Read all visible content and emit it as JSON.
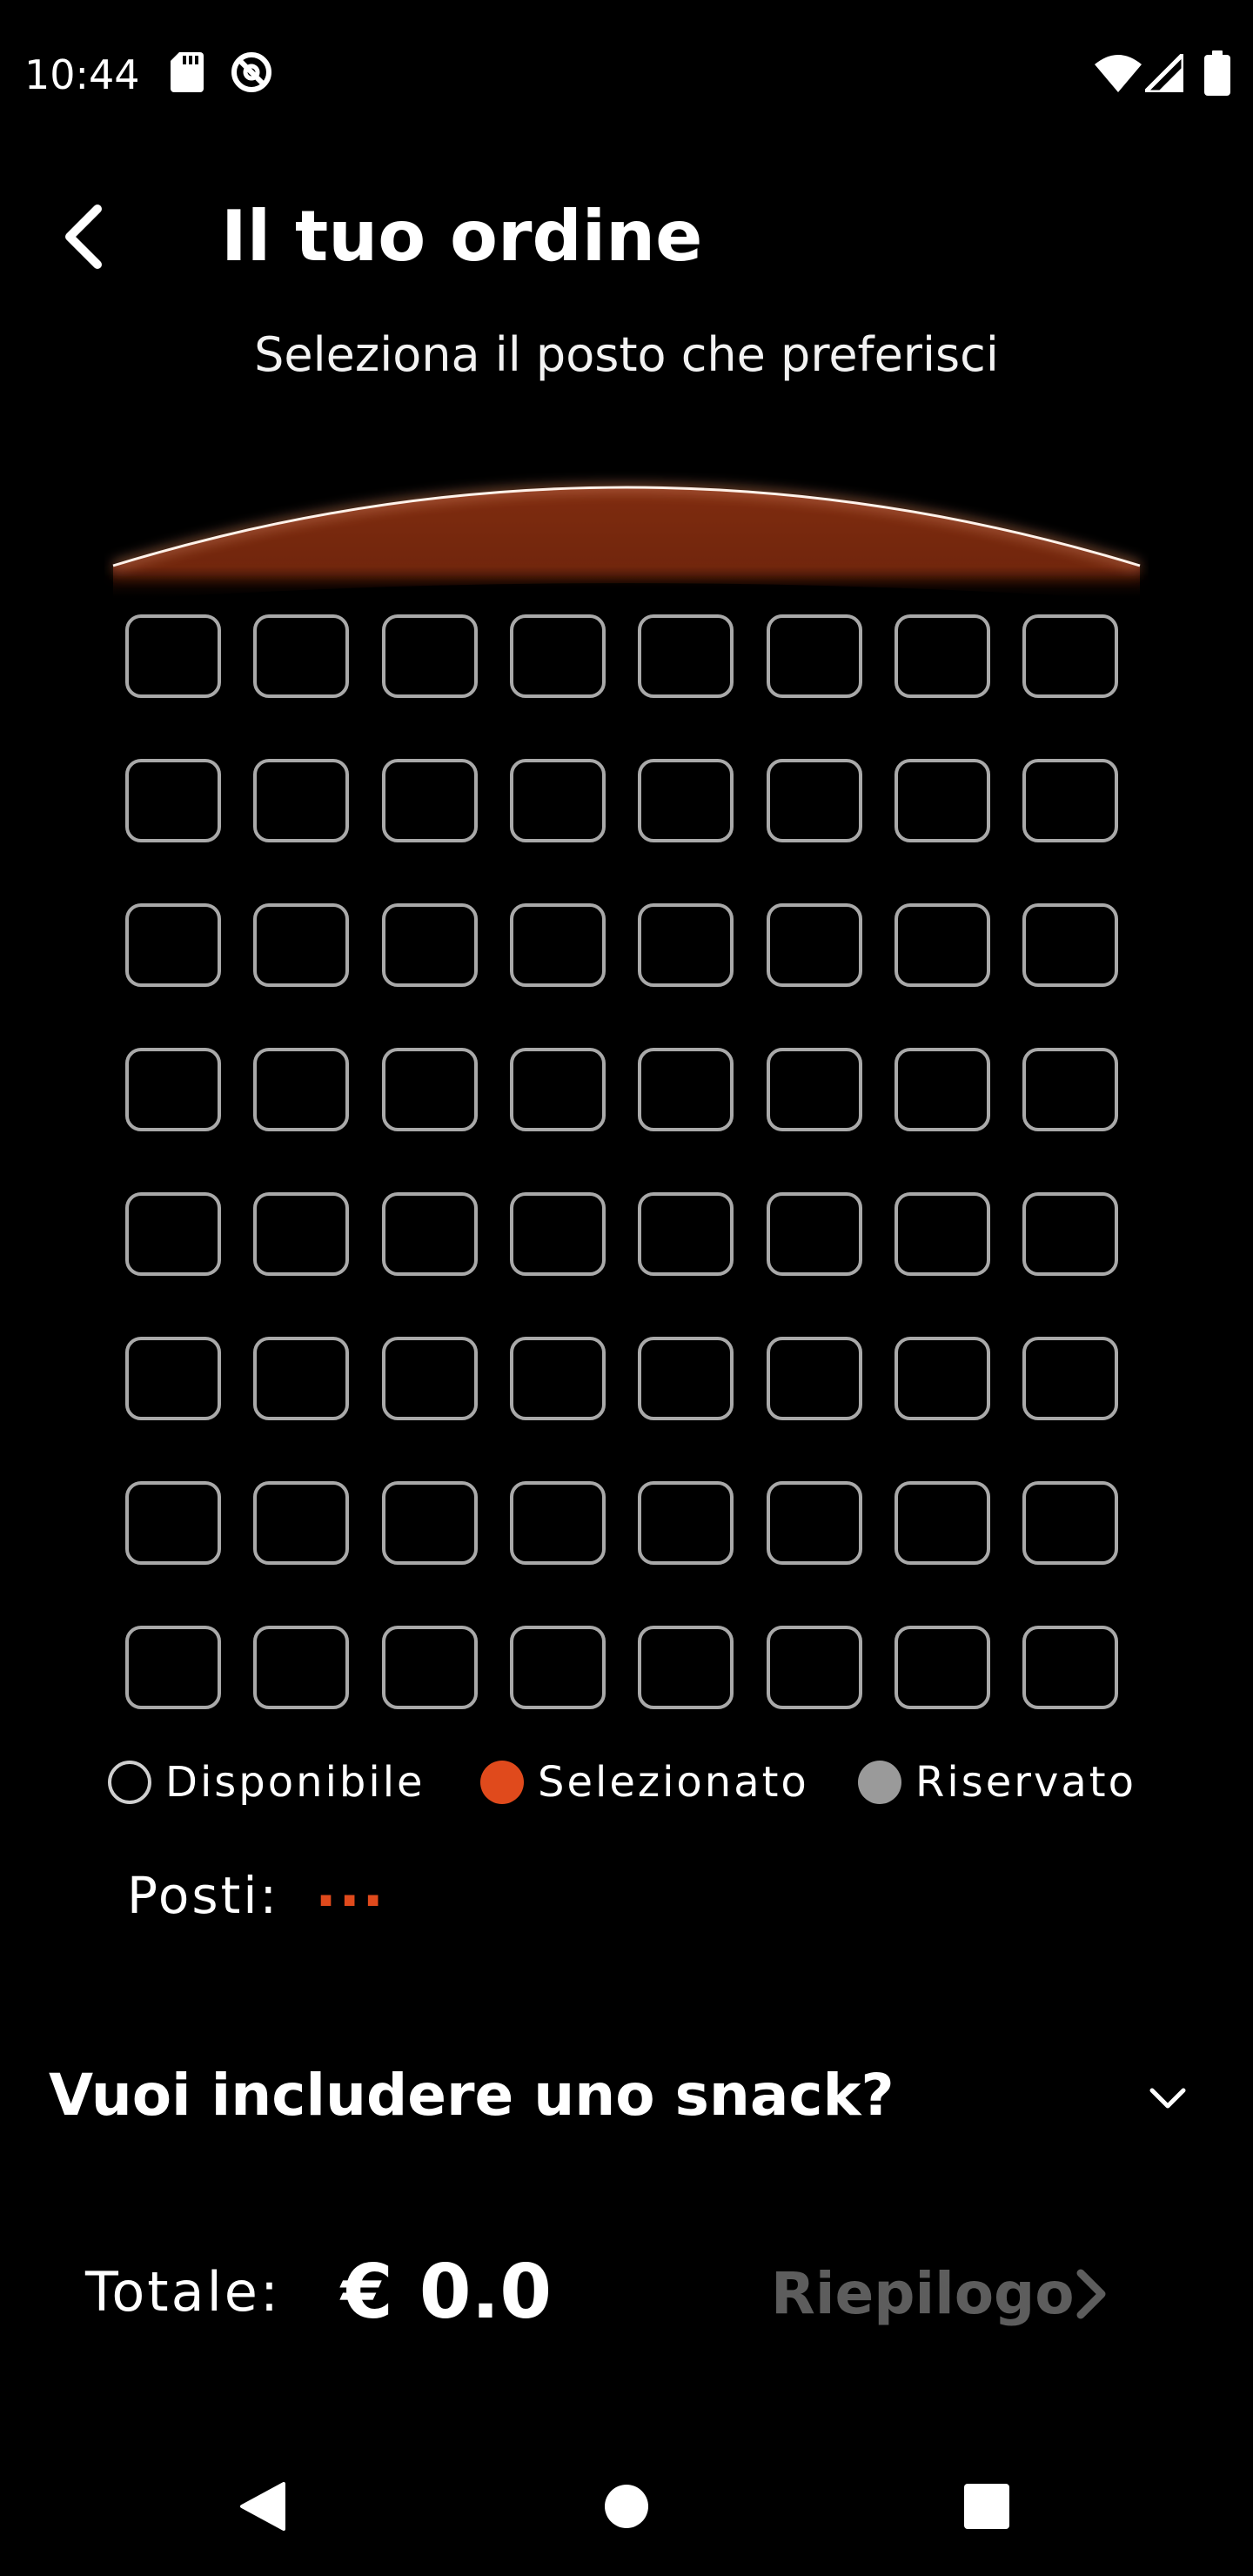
{
  "status_bar": {
    "time": "10:44",
    "left_icons": [
      "sd-card-icon",
      "data-saver-icon"
    ],
    "right_icons": [
      "wifi-icon",
      "cellular-signal-icon",
      "battery-icon"
    ]
  },
  "header": {
    "back_icon": "chevron-left-icon",
    "title": "Il tuo ordine"
  },
  "subtitle": "Seleziona il posto che preferisci",
  "seat_map": {
    "rows": 8,
    "columns": 8,
    "seat_state": "available",
    "selected_seats": [],
    "reserved_seats": []
  },
  "legend": {
    "available": {
      "label": "Disponibile",
      "color": "#000000",
      "border": "#cfcfcf"
    },
    "selected": {
      "label": "Selezionato",
      "color": "#e04a1c"
    },
    "reserved": {
      "label": "Riservato",
      "color": "#9a9a9a"
    }
  },
  "seats_summary": {
    "label": "Posti:",
    "value": "..."
  },
  "snack": {
    "question": "Vuoi includere uno snack?",
    "icon": "chevron-down-icon"
  },
  "total": {
    "label": "Totale:",
    "value": "€ 0.0"
  },
  "summary_button": {
    "label": "Riepilogo",
    "icon": "chevron-right-icon",
    "enabled": false
  },
  "nav_bar": {
    "back": "nav-back-icon",
    "home": "nav-home-icon",
    "recents": "nav-recents-icon"
  },
  "colors": {
    "background": "#000000",
    "accent": "#e04a1c",
    "screen_glow": "#8a2e12",
    "seat_border": "#a9a9a9",
    "disabled_text": "#5d5d5d"
  }
}
